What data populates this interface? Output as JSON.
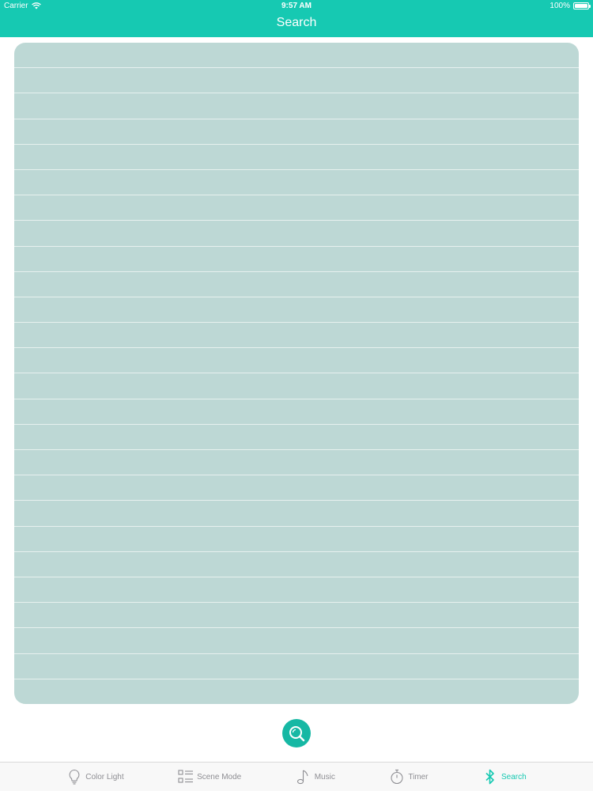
{
  "status_bar": {
    "carrier": "Carrier",
    "time": "9:57 AM",
    "battery_percent": "100%",
    "battery_level": 1.0,
    "wifi_icon": "wifi-icon",
    "battery_icon": "battery-icon"
  },
  "header": {
    "title": "Search",
    "background_color": "#16c9b2"
  },
  "device_list": {
    "rows": [
      "",
      "",
      "",
      "",
      "",
      "",
      "",
      "",
      "",
      "",
      "",
      "",
      "",
      "",
      "",
      "",
      "",
      "",
      "",
      "",
      "",
      "",
      "",
      "",
      "",
      ""
    ],
    "background_color": "#bdd8d5"
  },
  "scan_button": {
    "icon": "magnifier-icon",
    "color": "#16b8a4"
  },
  "tab_bar": {
    "tabs": [
      {
        "label": "Color Light",
        "icon": "lightbulb-icon",
        "active": false
      },
      {
        "label": "Scene Mode",
        "icon": "list-icon",
        "active": false
      },
      {
        "label": "Music",
        "icon": "music-note-icon",
        "active": false
      },
      {
        "label": "Timer",
        "icon": "stopwatch-icon",
        "active": false
      },
      {
        "label": "Search",
        "icon": "bluetooth-icon",
        "active": true
      }
    ],
    "active_color": "#16c9b2",
    "inactive_color": "#8e8e93"
  }
}
